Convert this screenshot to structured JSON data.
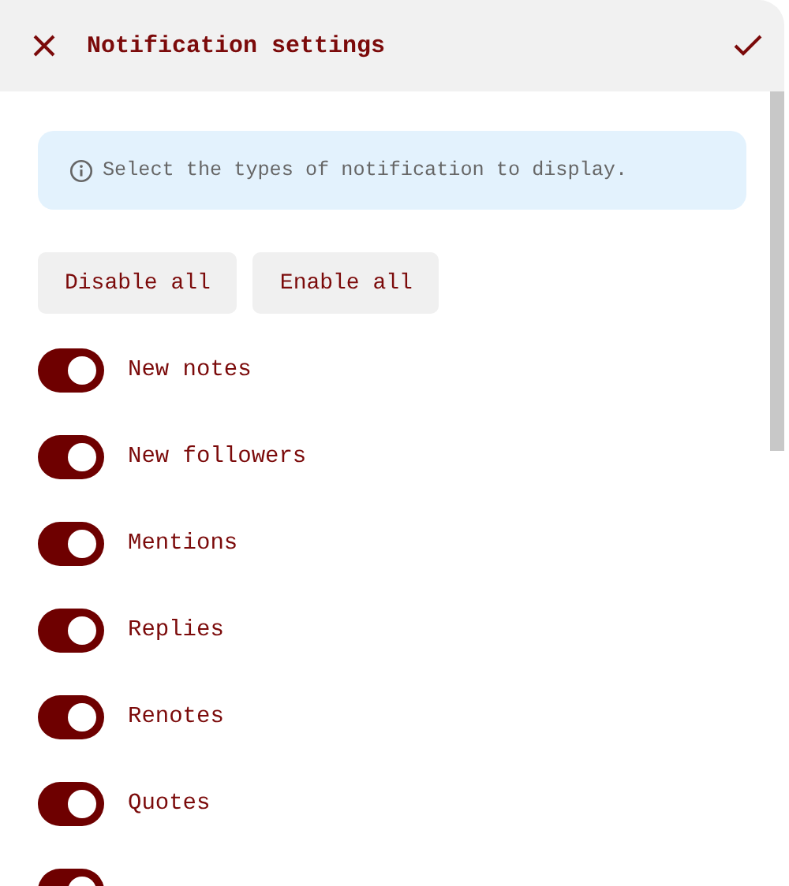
{
  "header": {
    "title": "Notification settings"
  },
  "info": {
    "text": "Select the types of notification to display."
  },
  "buttons": [
    "Disable all",
    "Enable all"
  ],
  "toggles": [
    {
      "label": "New notes",
      "on": true
    },
    {
      "label": "New followers",
      "on": true
    },
    {
      "label": "Mentions",
      "on": true
    },
    {
      "label": "Replies",
      "on": true
    },
    {
      "label": "Renotes",
      "on": true
    },
    {
      "label": "Quotes",
      "on": true
    },
    {
      "on": true
    }
  ]
}
